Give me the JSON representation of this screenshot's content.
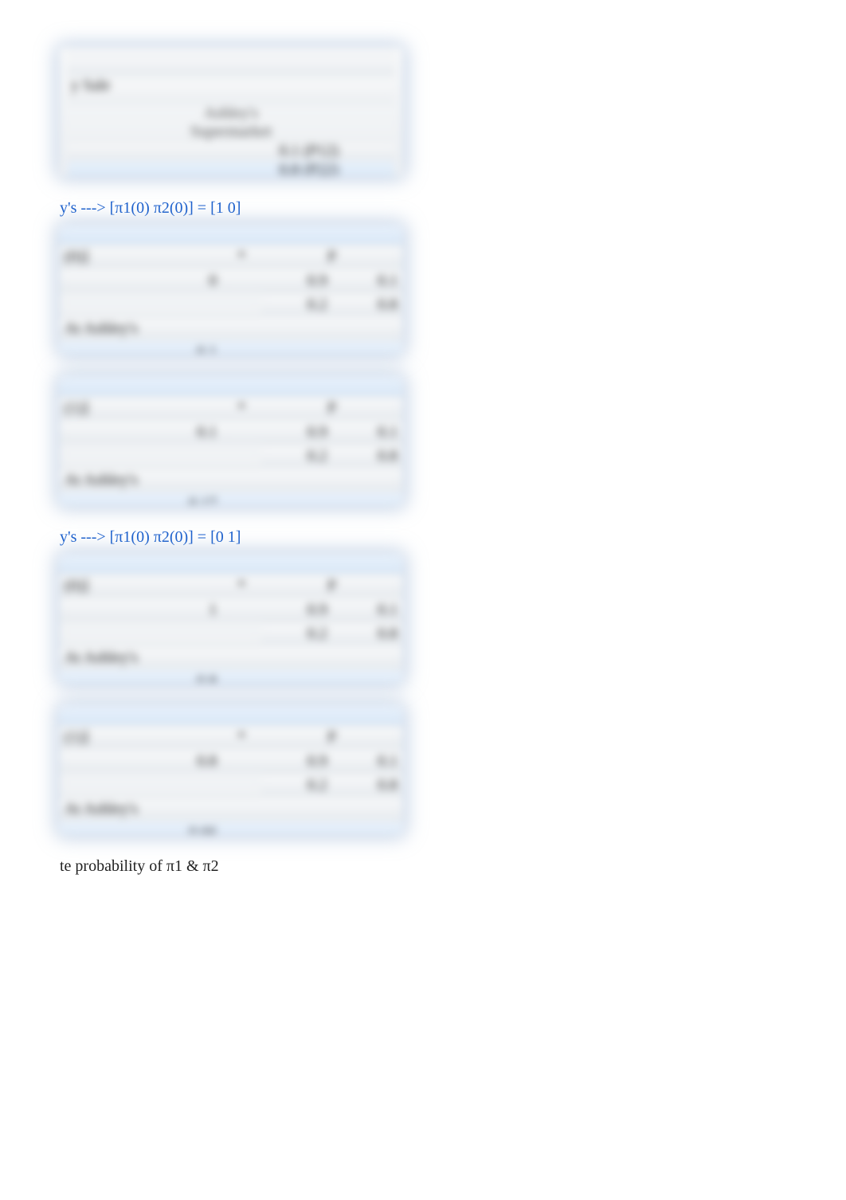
{
  "box_top": {
    "line1": "y Sale",
    "col_header1": "Ashley's",
    "col_header2": "Supermarket",
    "val1": "0.1 (P12)",
    "val2": "0.8 (P22)"
  },
  "header_a": "y's ---> [π1(0) π2(0)] = [1 0]",
  "header_b": "y's ---> [π1(0) π2(0)] = [0 1]",
  "blocks": [
    {
      "label": "(0)]",
      "left_val": "0",
      "ashley": "At Ashley's",
      "bottom_val": "0.1",
      "star": "*",
      "P": "P",
      "p11": "0.9",
      "p12": "0.1",
      "p21": "0.2",
      "p22": "0.8"
    },
    {
      "label": "(1)]",
      "left_val": "0.1",
      "ashley": "At Ashley's",
      "bottom_val": "0.17",
      "star": "*",
      "P": "P",
      "p11": "0.9",
      "p12": "0.1",
      "p21": "0.2",
      "p22": "0.8"
    },
    {
      "label": "(0)]",
      "left_val": "1",
      "ashley": "At Ashley's",
      "bottom_val": "0.8",
      "star": "*",
      "P": "P",
      "p11": "0.9",
      "p12": "0.1",
      "p21": "0.2",
      "p22": "0.8"
    },
    {
      "label": "(1)]",
      "left_val": "0.8",
      "ashley": "At Ashley's",
      "bottom_val": "0.66",
      "star": "*",
      "P": "P",
      "p11": "0.9",
      "p12": "0.1",
      "p21": "0.2",
      "p22": "0.8"
    }
  ],
  "footnote": "te probability of π1 & π2"
}
